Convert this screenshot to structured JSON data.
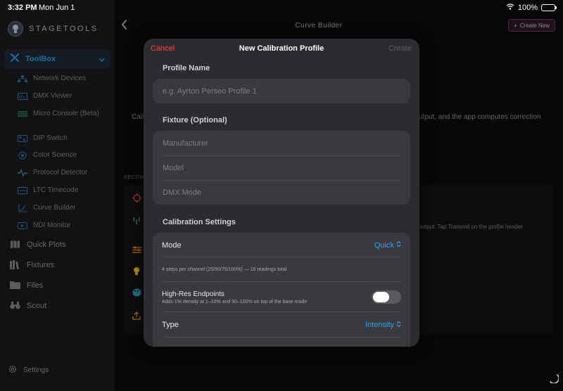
{
  "status_bar": {
    "time": "3:32 PM",
    "date": "Mon Jun 1",
    "battery": "100%"
  },
  "sidebar": {
    "brand": "STAGETOOLS",
    "toolbox_label": "ToolBox",
    "sub_items": [
      {
        "label": "Network Devices",
        "icon": "network-icon"
      },
      {
        "label": "DMX Viewer",
        "icon": "dmx-viewer-icon"
      },
      {
        "label": "Micro Console (Beta)",
        "icon": "console-icon"
      },
      {
        "label": "DIP Switch",
        "icon": "dip-switch-icon"
      },
      {
        "label": "Color Science",
        "icon": "color-science-icon"
      },
      {
        "label": "Protocol Detector",
        "icon": "protocol-icon"
      },
      {
        "label": "LTC Timecode",
        "icon": "timecode-icon"
      },
      {
        "label": "Curve Builder",
        "icon": "curve-icon"
      },
      {
        "label": "NDI Monitor",
        "icon": "ndi-icon"
      }
    ],
    "main_items": [
      {
        "label": "Quick Plots",
        "icon": "map-icon"
      },
      {
        "label": "Fixtures",
        "icon": "books-icon"
      },
      {
        "label": "Files",
        "icon": "folder-icon"
      },
      {
        "label": "Scout",
        "icon": "binoculars-icon"
      }
    ],
    "settings_label": "Settings"
  },
  "navbar": {
    "title": "Curve Builder",
    "create_new": "Create New"
  },
  "background": {
    "text_left": "Cali",
    "text_right": "utput, and the app computes correction",
    "recom_label": "RECOM",
    "card_text": "output. Tap Transmit on the profile header"
  },
  "modal": {
    "cancel": "Cancel",
    "title": "New Calibration Profile",
    "create": "Create",
    "profile_name_label": "Profile Name",
    "profile_name_placeholder": "e.g. Ayrton Perseo Profile 1",
    "fixture_label": "Fixture (Optional)",
    "manufacturer_placeholder": "Manufacturer",
    "model_placeholder": "Model",
    "dmx_mode_placeholder": "DMX Mode",
    "calibration_label": "Calibration Settings",
    "mode_title": "Mode",
    "mode_value": "Quick",
    "mode_description": "4 steps per channel (25/50/75/100%) — 16 readings total",
    "highres_title": "High-Res Endpoints",
    "highres_description": "Adds 1% density at 1–10% and 90–100% on top of the base mode",
    "highres_enabled": false,
    "type_title": "Type",
    "type_value": "Intensity"
  },
  "colors": {
    "accent_blue": "#2ea3f2",
    "destructive_red": "#ff453a",
    "modal_bg": "#2c2c30",
    "sidebar_bg": "#1c1c20"
  }
}
